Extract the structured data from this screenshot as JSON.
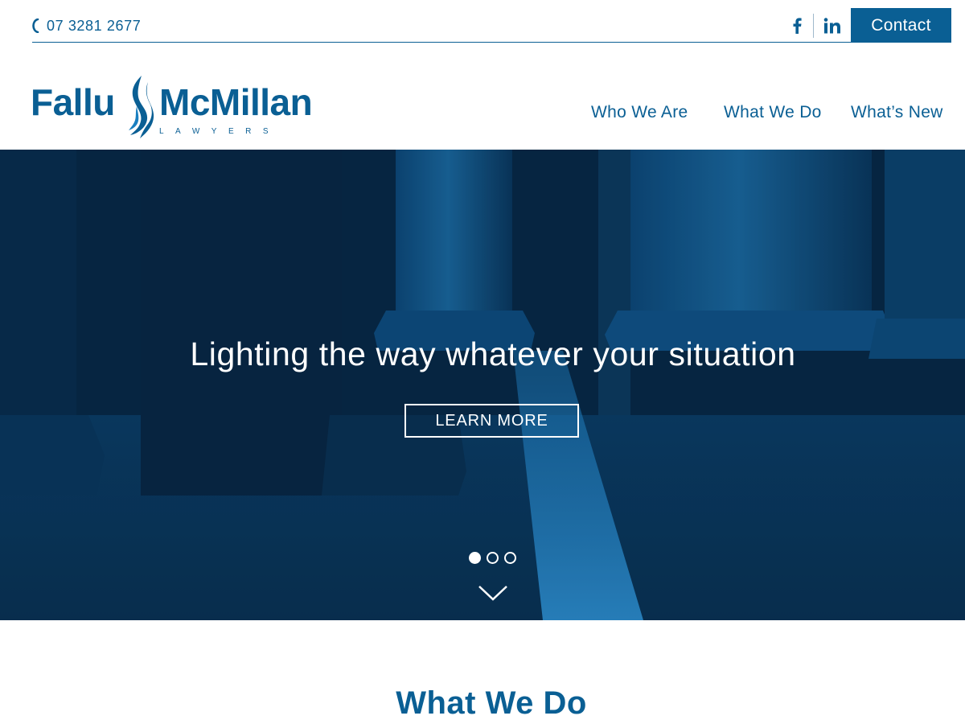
{
  "topbar": {
    "phone": "07 3281 2677",
    "phone_icon": "phone-icon",
    "social": [
      {
        "name": "facebook",
        "icon": "facebook-icon",
        "glyph": "f"
      },
      {
        "name": "linkedin",
        "icon": "linkedin-icon",
        "glyph": "in"
      }
    ],
    "contact_label": "Contact"
  },
  "logo": {
    "left_word": "Fallu",
    "right_word": "McMillan",
    "subtitle": "LAWYERS",
    "mark_icon": "flame-icon"
  },
  "nav": {
    "items": [
      {
        "label": "Who We Are"
      },
      {
        "label": "What We Do"
      },
      {
        "label": "What’s New"
      }
    ]
  },
  "hero": {
    "title": "Lighting the way whatever your situation",
    "cta_label": "LEARN MORE",
    "slides": {
      "count": 3,
      "active": 1
    },
    "scroll_icon": "chevron-down-icon"
  },
  "section": {
    "title": "What We Do"
  },
  "colors": {
    "brand": "#0a5f94",
    "hero_dark": "#072a48",
    "white": "#ffffff"
  }
}
